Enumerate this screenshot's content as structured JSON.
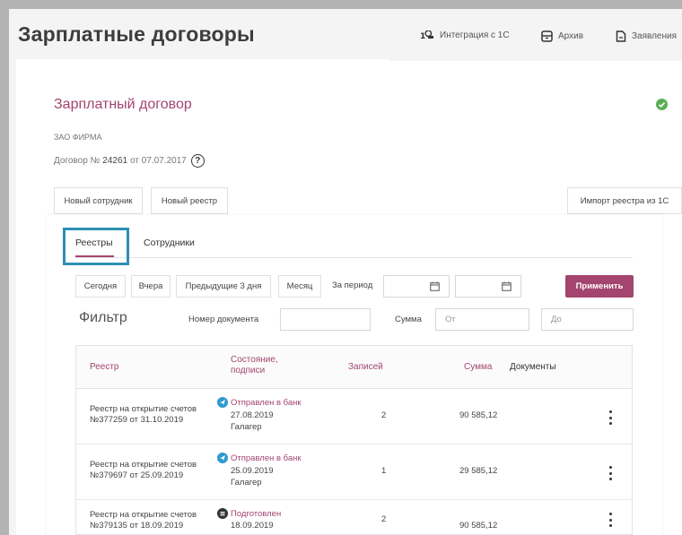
{
  "page": {
    "title": "Зарплатные договоры"
  },
  "top_nav": [
    {
      "label": "Интеграция с 1С",
      "icon": "integration-1c-icon"
    },
    {
      "label": "Архив",
      "icon": "archive-icon"
    },
    {
      "label": "Заявления",
      "icon": "document-icon"
    }
  ],
  "contract": {
    "title": "Зарплатный договор",
    "company": "ЗАО ФИРМА",
    "number_prefix": "Договор №",
    "number": "24261",
    "date_text": "от 07.07.2017",
    "help": "?",
    "status_color": "#5cae55"
  },
  "actions": {
    "new_employee": "Новый сотрудник",
    "new_registry": "Новый реестр",
    "import_1c": "Импорт реестра из 1С"
  },
  "tabs": [
    {
      "label": "Реестры",
      "active": true
    },
    {
      "label": "Сотрудники",
      "active": false
    }
  ],
  "quick_filters": {
    "today": "Сегодня",
    "yesterday": "Вчера",
    "prev3": "Предыдущие 3 дня",
    "month": "Месяц",
    "period_label": "За период",
    "apply": "Применить"
  },
  "filter": {
    "title": "Фильтр",
    "doc_number_label": "Номер документа",
    "sum_label": "Сумма",
    "from_placeholder": "От",
    "to_placeholder": "До"
  },
  "table": {
    "headers": {
      "registry": "Реестр",
      "state_line1": "Состояние,",
      "state_line2": "подписи",
      "records": "Записей",
      "sum": "Сумма",
      "documents": "Документы"
    },
    "rows": [
      {
        "name_line1": "Реестр на открытие счетов",
        "name_line2": "№377259 от 31.10.2019",
        "status": "Отправлен в банк",
        "status_icon": "sent-icon",
        "date": "27.08.2019",
        "signer": "Галагер",
        "records": "2",
        "sum": "90 585,12"
      },
      {
        "name_line1": "Реестр на открытие счетов",
        "name_line2": "№379697 от 25.09.2019",
        "status": "Отправлен в банк",
        "status_icon": "sent-icon",
        "date": "25.09.2019",
        "signer": "Галагер",
        "records": "1",
        "sum": "29 585,12"
      },
      {
        "name_line1": "Реестр на открытие счетов",
        "name_line2": "№379135 от 18.09.2019",
        "status": "Подготовлен",
        "status_icon": "prepared-icon",
        "date": "18.09.2019",
        "signer": "",
        "records": "2",
        "sum": "90 585,12"
      }
    ]
  },
  "colors": {
    "accent": "#a3456f",
    "highlight": "#2e8fb1",
    "sent": "#2e9ad0",
    "prepared": "#333333"
  }
}
